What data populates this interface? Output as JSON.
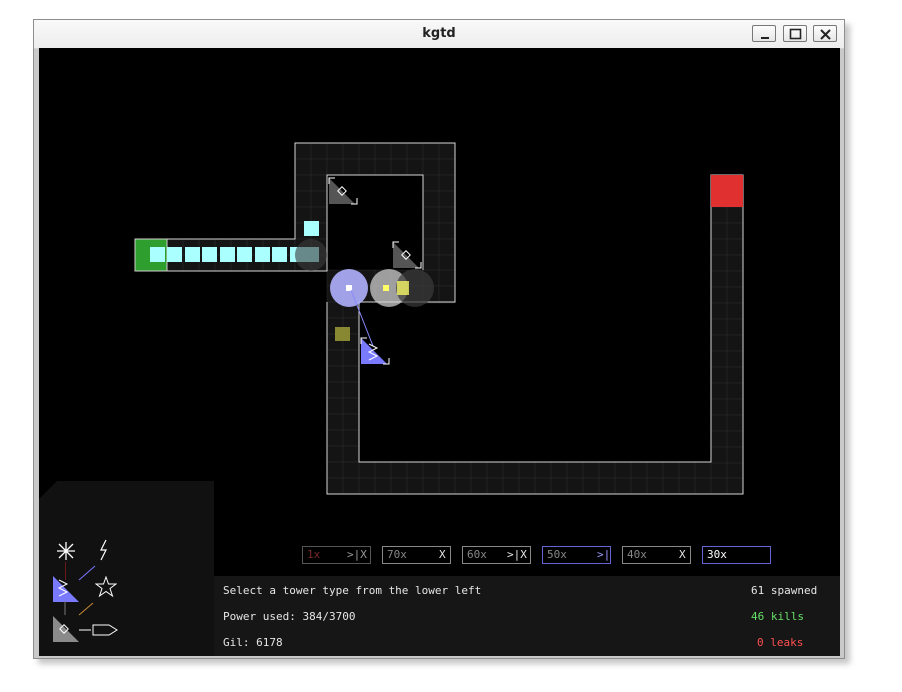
{
  "window": {
    "title": "kgtd"
  },
  "titlebar": {
    "minimize_icon": "minimize-icon",
    "maximize_icon": "maximize-icon",
    "close_icon": "close-icon"
  },
  "colors": {
    "path_cell": "#141414",
    "path_grid": "#2a2a2a",
    "path_outline": "#d6d6d6",
    "creep": "#aaffff",
    "spawn": "#2e9e2e",
    "exit": "#e03030",
    "slow_tower": "#7a7aff",
    "pulse_range": "#b0b0ff",
    "flak_range": "#d8d8d8",
    "bullet": "#ffff66",
    "green_text": "#66e066",
    "red_text": "#ff5050"
  },
  "palette": {
    "tools": [
      {
        "id": "burst",
        "icon": "asterisk-icon"
      },
      {
        "id": "lightning",
        "icon": "lightning-icon"
      },
      {
        "id": "slow",
        "icon": "zigzag-triangle-icon"
      },
      {
        "id": "star",
        "icon": "star-icon"
      },
      {
        "id": "laser",
        "icon": "diamond-triangle-icon"
      },
      {
        "id": "rocket",
        "icon": "rocket-icon"
      }
    ]
  },
  "speeds": [
    {
      "label": "1x",
      "icons": ">|X",
      "dim": true
    },
    {
      "label": "70x",
      "icons": "X"
    },
    {
      "label": "60x",
      "icons": ">|X"
    },
    {
      "label": "50x",
      "icons": ">|",
      "selected": true
    },
    {
      "label": "40x",
      "icons": "X"
    },
    {
      "label": "30x",
      "icons": "",
      "active": true
    }
  ],
  "status": {
    "hint": "Select a tower type from the lower left",
    "power": "Power used: 384/3700",
    "gil": "Gil: 6178",
    "spawned": "61 spawned",
    "kills": "46 kills",
    "leaks": "0 leaks"
  }
}
